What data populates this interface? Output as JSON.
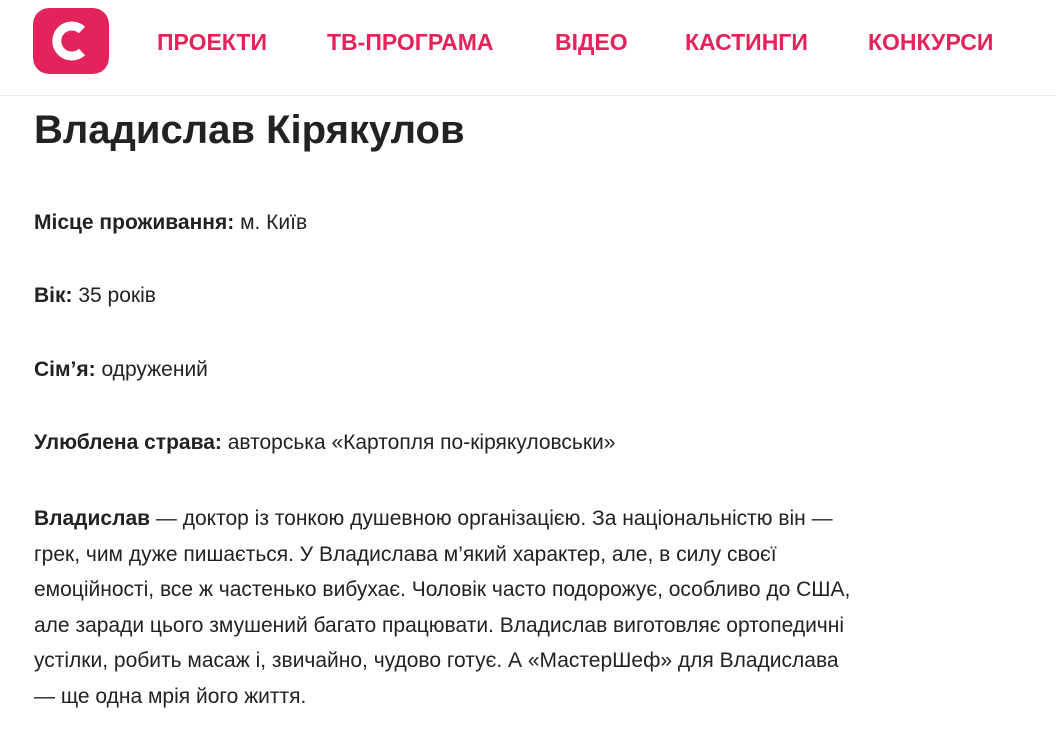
{
  "brand": {
    "logo_letter": "C",
    "accent_color": "#e3235a"
  },
  "nav": {
    "items": [
      {
        "label": "ПРОЕКТИ"
      },
      {
        "label": "ТВ-ПРОГРАМА"
      },
      {
        "label": "ВІДЕО"
      },
      {
        "label": "КАСТИНГИ"
      },
      {
        "label": "КОНКУРСИ"
      }
    ]
  },
  "profile": {
    "name": "Владислав Кірякулов",
    "fields": [
      {
        "label": "Місце проживання:",
        "value": "м. Київ"
      },
      {
        "label": "Вік:",
        "value": "35 років"
      },
      {
        "label": "Сім’я:",
        "value": "одружений"
      },
      {
        "label": "Улюблена страва:",
        "value": "авторська «Картопля по-кірякуловськи»"
      }
    ],
    "bio": {
      "name": "Владислав",
      "lines": [
        " — доктор із тонкою душевною організацією. За національністю він —",
        "грек, чим дуже пишається. У Владислава м’який характер, але, в силу своєї",
        "емоційності, все ж частенько вибухає. Чоловік часто подорожує, особливо до США,",
        "але заради цього змушений багато працювати. Владислав виготовляє ортопедичні",
        "устілки, робить масаж і, звичайно, чудово готує. А «МастерШеф» для Владислава",
        "— ще одна мрія його життя."
      ]
    }
  }
}
